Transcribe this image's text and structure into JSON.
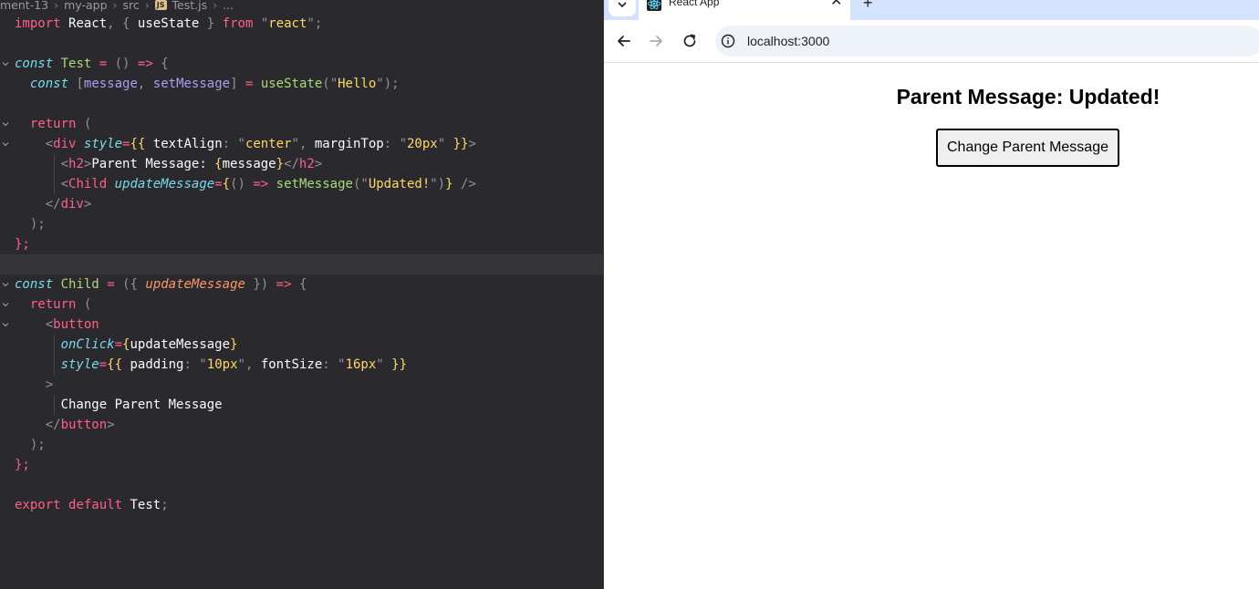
{
  "editor": {
    "breadcrumb": {
      "parts": [
        "ment-13",
        "my-app",
        "src"
      ],
      "file_badge": "JS",
      "file": "Test.js",
      "trail": "..."
    }
  },
  "browser": {
    "tab_title": "React App",
    "tab_close": "✕",
    "new_tab": "+",
    "url": "localhost:3000",
    "page": {
      "heading": "Parent Message: Updated!",
      "button_label": "Change Parent Message"
    }
  },
  "colors": {
    "editor_bg": "#2a292d",
    "keyword": "#ff6188",
    "type": "#78dce8",
    "function": "#a9dc76",
    "string": "#ffd866",
    "variable": "#ab9df2",
    "tabstrip": "#d3e3fd"
  },
  "icons": [
    "chevron-down-icon",
    "react-icon",
    "back-arrow-icon",
    "forward-arrow-icon",
    "reload-icon",
    "info-icon",
    "fold-chevron-icon"
  ]
}
